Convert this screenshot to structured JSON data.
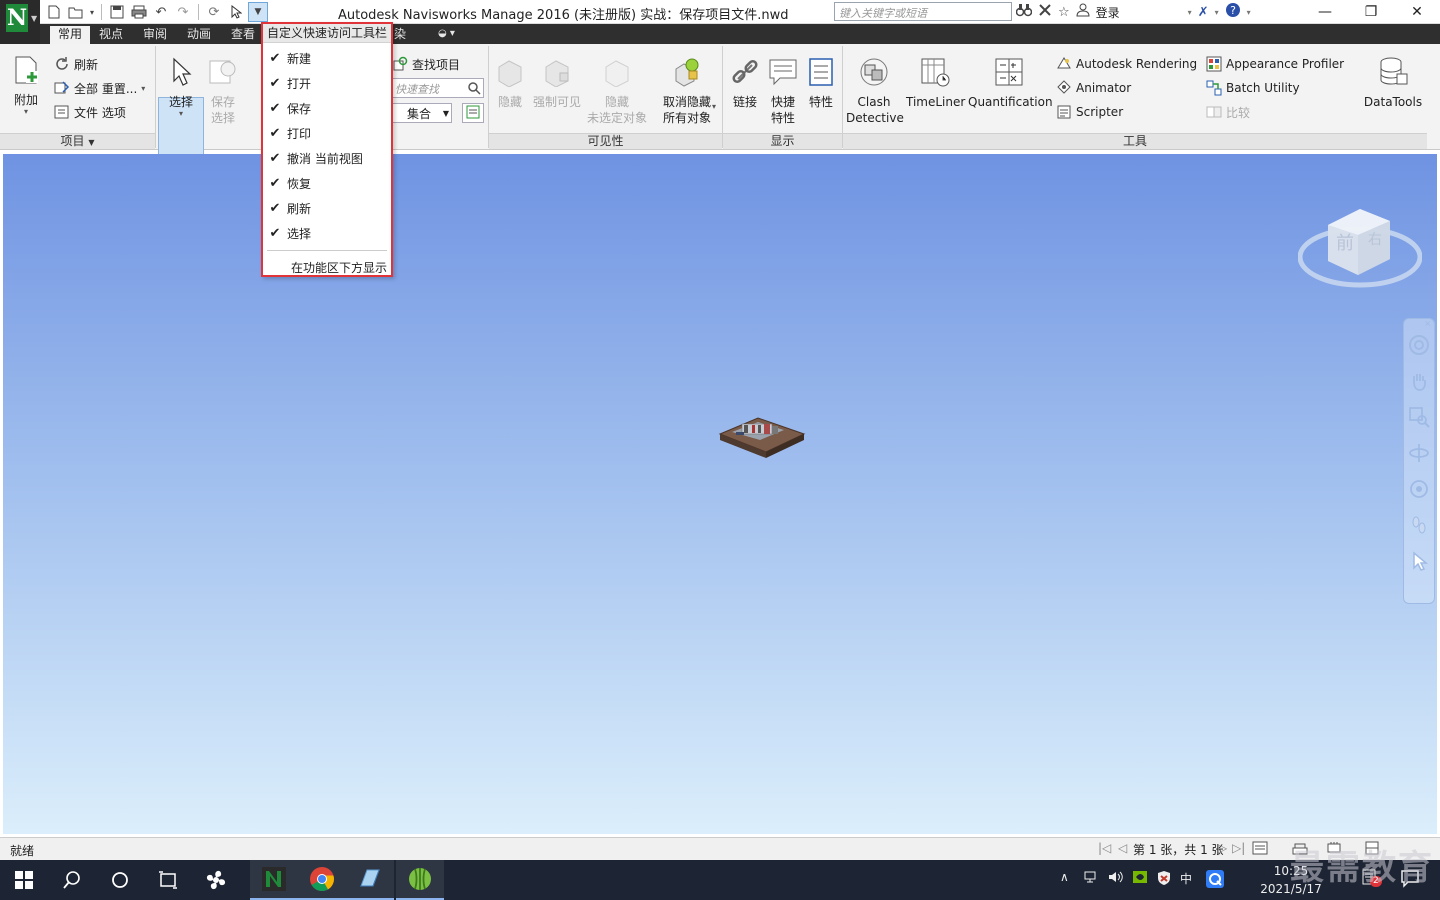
{
  "window": {
    "title": "Autodesk Navisworks Manage 2016 (未注册版)    实战：保存项目文件.nwd",
    "search_placeholder": "键入关键字或短语",
    "login_label": "登录",
    "minimize": "—",
    "restore": "❐",
    "close": "✕"
  },
  "app_logo": {
    "letter": "N"
  },
  "ribbon_tabs": [
    "常用",
    "视点",
    "审阅",
    "动画",
    "查看",
    "染"
  ],
  "ribbon": {
    "project": {
      "title": "项目",
      "append": "附加",
      "refresh": "刷新",
      "reset_all": "全部 重置...",
      "file_options": "文件 选项"
    },
    "select": {
      "select": "选择",
      "save_selection_1": "保存",
      "save_selection_2": "选择",
      "find_items": "查找项目",
      "quick_find_placeholder": "快速查找",
      "sets": "集合"
    },
    "visibility": {
      "title": "可见性",
      "hide": "隐藏",
      "require": "强制可见",
      "hide_unselected_1": "隐藏",
      "hide_unselected_2": "未选定对象",
      "unhide_all_1": "取消隐藏",
      "unhide_all_2": "所有对象"
    },
    "display": {
      "title": "显示",
      "links": "链接",
      "quick_props_1": "快捷",
      "quick_props_2": "特性",
      "properties": "特性"
    },
    "tools": {
      "title": "工具",
      "clash_1": "Clash",
      "clash_2": "Detective",
      "timeliner": "TimeLiner",
      "quantification": "Quantification",
      "autodesk_rendering": "Autodesk Rendering",
      "animator": "Animator",
      "scripter": "Scripter",
      "appearance_profiler": "Appearance Profiler",
      "batch_utility": "Batch Utility",
      "compare": "比较",
      "datatools": "DataTools"
    }
  },
  "qat_menu": {
    "header": "自定义快速访问工具栏",
    "items": [
      {
        "label": "新建",
        "checked": true
      },
      {
        "label": "打开",
        "checked": true
      },
      {
        "label": "保存",
        "checked": true
      },
      {
        "label": "打印",
        "checked": true
      },
      {
        "label": "撤消 当前视图",
        "checked": true
      },
      {
        "label": "恢复",
        "checked": true
      },
      {
        "label": "刷新",
        "checked": true
      },
      {
        "label": "选择",
        "checked": true
      }
    ],
    "show_below": "在功能区下方显示"
  },
  "viewcube": {
    "face_label": "前",
    "right_label": "右"
  },
  "status": {
    "text": "就绪",
    "page_info": "第 1 张，共 1 张"
  },
  "taskbar": {
    "time": "10:25",
    "date": "2021/5/17",
    "ime": "中",
    "badge": "2"
  },
  "watermark": "最需教育",
  "colors": {
    "accent_red": "#e0333a",
    "tab_bar": "#2f2f2f",
    "taskbar": "#1d2433",
    "viewport_top": "#6f93e2",
    "viewport_bottom": "#dbeefb"
  }
}
